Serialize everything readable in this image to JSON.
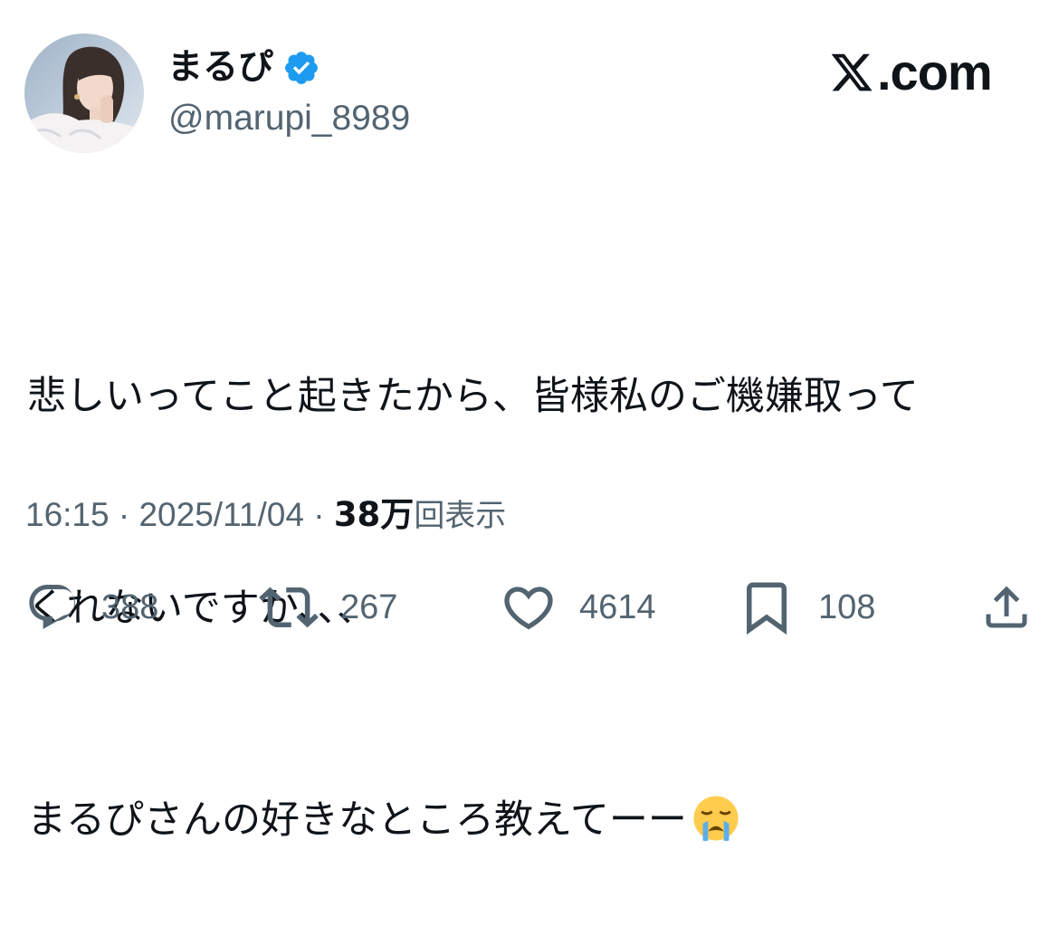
{
  "author": {
    "display_name": "まるぴ",
    "handle": "@marupi_8989",
    "verified_icon": "verified-badge-icon",
    "avatar": "profile-photo"
  },
  "brand": {
    "label": ".com",
    "logo_icon": "x-logo-icon"
  },
  "tweet": {
    "lines": [
      "悲しいってこと起きたから、皆様私のご機嫌取って",
      "くれないですか、、、",
      "まるぴさんの好きなところ教えてーー"
    ],
    "trailing_emoji": "loudly-crying-face-emoji"
  },
  "meta": {
    "time": "16:15",
    "separator": "·",
    "date": "2025/11/04",
    "views_count": "38万",
    "views_label": "回表示"
  },
  "actions": {
    "replies": "388",
    "reposts": "267",
    "likes": "4614",
    "bookmarks": "108"
  },
  "colors": {
    "text": "#0f1419",
    "secondary": "#536471",
    "verified": "#1d9bf0",
    "emoji": "#ffcc4d"
  }
}
